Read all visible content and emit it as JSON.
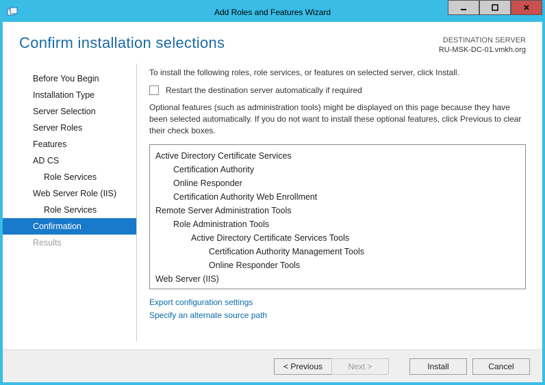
{
  "window": {
    "title": "Add Roles and Features Wizard"
  },
  "header": {
    "heading": "Confirm installation selections",
    "dest_label": "DESTINATION SERVER",
    "dest_server": "RU-MSK-DC-01.vmkh.org"
  },
  "nav": {
    "items": [
      {
        "label": "Before You Begin",
        "sub": false,
        "selected": false,
        "disabled": false
      },
      {
        "label": "Installation Type",
        "sub": false,
        "selected": false,
        "disabled": false
      },
      {
        "label": "Server Selection",
        "sub": false,
        "selected": false,
        "disabled": false
      },
      {
        "label": "Server Roles",
        "sub": false,
        "selected": false,
        "disabled": false
      },
      {
        "label": "Features",
        "sub": false,
        "selected": false,
        "disabled": false
      },
      {
        "label": "AD CS",
        "sub": false,
        "selected": false,
        "disabled": false
      },
      {
        "label": "Role Services",
        "sub": true,
        "selected": false,
        "disabled": false
      },
      {
        "label": "Web Server Role (IIS)",
        "sub": false,
        "selected": false,
        "disabled": false
      },
      {
        "label": "Role Services",
        "sub": true,
        "selected": false,
        "disabled": false
      },
      {
        "label": "Confirmation",
        "sub": false,
        "selected": true,
        "disabled": false
      },
      {
        "label": "Results",
        "sub": false,
        "selected": false,
        "disabled": true
      }
    ]
  },
  "content": {
    "intro": "To install the following roles, role services, or features on selected server, click Install.",
    "restart_label": "Restart the destination server automatically if required",
    "optional_note": "Optional features (such as administration tools) might be displayed on this page because they have been selected automatically. If you do not want to install these optional features, click Previous to clear their check boxes.",
    "tree": [
      {
        "level": 0,
        "text": "Active Directory Certificate Services"
      },
      {
        "level": 1,
        "text": "Certification Authority"
      },
      {
        "level": 1,
        "text": "Online Responder"
      },
      {
        "level": 1,
        "text": "Certification Authority Web Enrollment"
      },
      {
        "level": 0,
        "text": "Remote Server Administration Tools"
      },
      {
        "level": 1,
        "text": "Role Administration Tools"
      },
      {
        "level": 2,
        "text": "Active Directory Certificate Services Tools"
      },
      {
        "level": 3,
        "text": "Certification Authority Management Tools"
      },
      {
        "level": 3,
        "text": "Online Responder Tools"
      },
      {
        "level": 0,
        "text": "Web Server (IIS)"
      }
    ],
    "link_export": "Export configuration settings",
    "link_altpath": "Specify an alternate source path"
  },
  "footer": {
    "previous": "< Previous",
    "next": "Next >",
    "install": "Install",
    "cancel": "Cancel"
  }
}
